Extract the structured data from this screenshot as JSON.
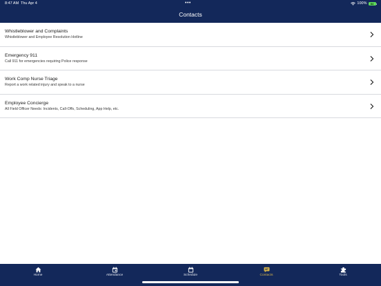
{
  "status_bar": {
    "time": "8:47 AM",
    "date": "Thu Apr 4",
    "battery_percent": "100%",
    "battery_label": "84"
  },
  "header": {
    "title": "Contacts"
  },
  "contacts": [
    {
      "name": "Whistleblower and Complaints",
      "description": "Whistleblower and Employee Resolution Hotline"
    },
    {
      "name": "Emergency 911",
      "description": "Call 911 for emergencies requiring Police response"
    },
    {
      "name": "Work Comp Nurse Triage",
      "description": "Report a work related injury and speak to a nurse"
    },
    {
      "name": "Employee Concierge",
      "description": "All Field Officer Needs: Incidents, Call-Offs, Scheduling, App Help, etc."
    }
  ],
  "tabs": [
    {
      "label": "Home",
      "icon": "home-icon",
      "active": false
    },
    {
      "label": "Attendance",
      "icon": "calendar-check-icon",
      "active": false
    },
    {
      "label": "Schedule",
      "icon": "calendar-icon",
      "active": false
    },
    {
      "label": "Contacts",
      "icon": "chat-bubble-icon",
      "active": true
    },
    {
      "label": "Tools",
      "icon": "puzzle-piece-icon",
      "active": false
    }
  ],
  "colors": {
    "header_bg": "#13285a",
    "tab_active": "#d9b64a",
    "battery": "#5dd85a"
  }
}
